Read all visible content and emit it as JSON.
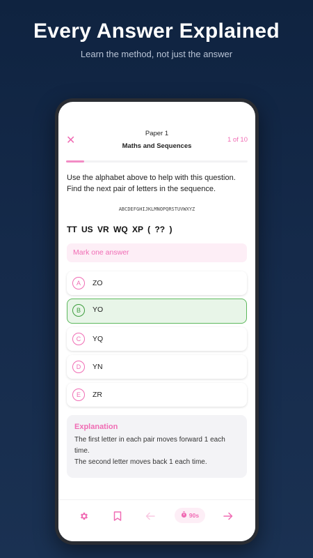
{
  "hero": {
    "title": "Every Answer Explained",
    "subtitle": "Learn the method, not just the answer"
  },
  "header": {
    "paper": "Paper 1",
    "topic": "Maths and Sequences",
    "counter": "1 of 10",
    "close_icon": "close-icon",
    "progress_fraction": 0.1
  },
  "question": {
    "text": "Use the alphabet above to help with this question. Find the next pair of letters in the sequence.",
    "alphabet": "ABCDEFGHIJKLMNOPQRSTUVWXYZ",
    "sequence": "TT US VR WQ XP ( ?? )"
  },
  "answer_prompt": "Mark one answer",
  "options": [
    {
      "letter": "A",
      "text": "ZO",
      "correct": false
    },
    {
      "letter": "B",
      "text": "YO",
      "correct": true
    },
    {
      "letter": "C",
      "text": "YQ",
      "correct": false
    },
    {
      "letter": "D",
      "text": "YN",
      "correct": false
    },
    {
      "letter": "E",
      "text": "ZR",
      "correct": false
    }
  ],
  "explanation": {
    "title": "Explanation",
    "body": "The first letter in each pair moves forward 1 each time.\nThe second letter moves back 1 each time."
  },
  "bottom_bar": {
    "timer": "90s",
    "icons": [
      "gear-icon",
      "bookmark-icon",
      "arrow-left-icon",
      "stopwatch-icon",
      "arrow-right-icon"
    ]
  },
  "colors": {
    "accent": "#f06cb4",
    "correct": "#5cb85c",
    "background": "#152a4a"
  }
}
